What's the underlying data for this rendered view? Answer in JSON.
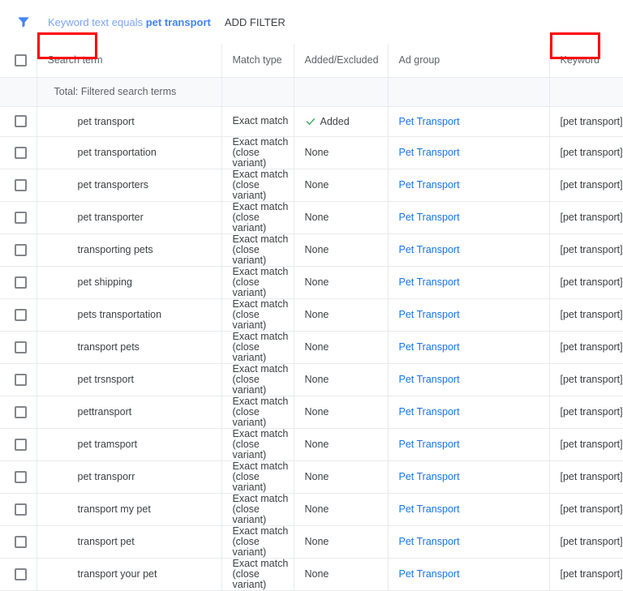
{
  "filter_bar": {
    "filter_icon": "filter-funnel-icon",
    "chip_label": "Keyword text equals",
    "chip_value": "pet transport",
    "add_filter_label": "ADD FILTER",
    "chip_color": "#4285f4",
    "add_filter_color": "#3c4043"
  },
  "table": {
    "select_all_checkbox": "",
    "columns": [
      {
        "key": "checkbox",
        "label": ""
      },
      {
        "key": "search_term",
        "label": "Search term",
        "annotated": true
      },
      {
        "key": "match_type",
        "label": "Match type"
      },
      {
        "key": "added_excluded",
        "label": "Added/Excluded"
      },
      {
        "key": "ad_group",
        "label": "Ad group"
      },
      {
        "key": "keyword",
        "label": "Keyword",
        "annotated": true
      }
    ],
    "total_row": {
      "label": "Total: Filtered search terms"
    },
    "annotation_color": "#ff0000",
    "match_exact": "Exact match",
    "match_close_variant": "(close variant)",
    "added_label": "Added",
    "added_icon": "green-check-icon",
    "added_icon_color": "#34a853",
    "none_label": "None",
    "ad_group_label": "Pet Transport",
    "ad_group_link_color": "#1a73e8",
    "keyword_label": "[pet transport]",
    "rows": [
      {
        "search_term": "pet transport",
        "match_main": "Exact match",
        "match_sub": "",
        "status": "Added",
        "has_check": true,
        "ad_group": "Pet Transport",
        "keyword": "[pet transport]"
      },
      {
        "search_term": "pet transportation",
        "match_main": "Exact match",
        "match_sub": "(close variant)",
        "status": "None",
        "has_check": false,
        "ad_group": "Pet Transport",
        "keyword": "[pet transport]"
      },
      {
        "search_term": "pet transporters",
        "match_main": "Exact match",
        "match_sub": "(close variant)",
        "status": "None",
        "has_check": false,
        "ad_group": "Pet Transport",
        "keyword": "[pet transport]"
      },
      {
        "search_term": "pet transporter",
        "match_main": "Exact match",
        "match_sub": "(close variant)",
        "status": "None",
        "has_check": false,
        "ad_group": "Pet Transport",
        "keyword": "[pet transport]"
      },
      {
        "search_term": "transporting pets",
        "match_main": "Exact match",
        "match_sub": "(close variant)",
        "status": "None",
        "has_check": false,
        "ad_group": "Pet Transport",
        "keyword": "[pet transport]"
      },
      {
        "search_term": "pet shipping",
        "match_main": "Exact match",
        "match_sub": "(close variant)",
        "status": "None",
        "has_check": false,
        "ad_group": "Pet Transport",
        "keyword": "[pet transport]"
      },
      {
        "search_term": "pets transportation",
        "match_main": "Exact match",
        "match_sub": "(close variant)",
        "status": "None",
        "has_check": false,
        "ad_group": "Pet Transport",
        "keyword": "[pet transport]"
      },
      {
        "search_term": "transport pets",
        "match_main": "Exact match",
        "match_sub": "(close variant)",
        "status": "None",
        "has_check": false,
        "ad_group": "Pet Transport",
        "keyword": "[pet transport]"
      },
      {
        "search_term": "pet trsnsport",
        "match_main": "Exact match",
        "match_sub": "(close variant)",
        "status": "None",
        "has_check": false,
        "ad_group": "Pet Transport",
        "keyword": "[pet transport]"
      },
      {
        "search_term": "pettransport",
        "match_main": "Exact match",
        "match_sub": "(close variant)",
        "status": "None",
        "has_check": false,
        "ad_group": "Pet Transport",
        "keyword": "[pet transport]"
      },
      {
        "search_term": "pet tramsport",
        "match_main": "Exact match",
        "match_sub": "(close variant)",
        "status": "None",
        "has_check": false,
        "ad_group": "Pet Transport",
        "keyword": "[pet transport]"
      },
      {
        "search_term": "pet transporr",
        "match_main": "Exact match",
        "match_sub": "(close variant)",
        "status": "None",
        "has_check": false,
        "ad_group": "Pet Transport",
        "keyword": "[pet transport]"
      },
      {
        "search_term": "transport my pet",
        "match_main": "Exact match",
        "match_sub": "(close variant)",
        "status": "None",
        "has_check": false,
        "ad_group": "Pet Transport",
        "keyword": "[pet transport]"
      },
      {
        "search_term": "transport pet",
        "match_main": "Exact match",
        "match_sub": "(close variant)",
        "status": "None",
        "has_check": false,
        "ad_group": "Pet Transport",
        "keyword": "[pet transport]"
      },
      {
        "search_term": "transport your pet",
        "match_main": "Exact match",
        "match_sub": "(close variant)",
        "status": "None",
        "has_check": false,
        "ad_group": "Pet Transport",
        "keyword": "[pet transport]"
      }
    ]
  }
}
